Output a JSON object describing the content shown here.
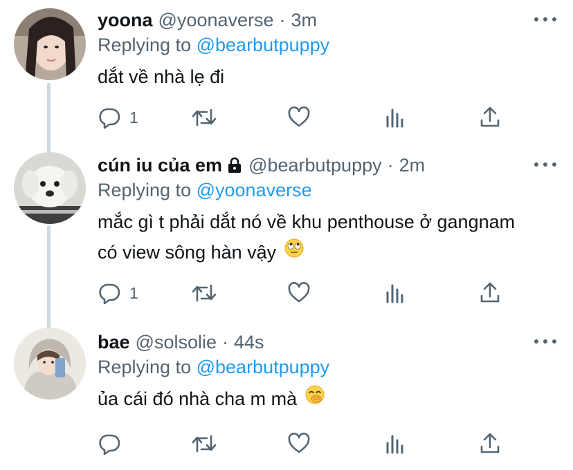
{
  "colors": {
    "accent": "#1d9bf0",
    "secondary_text": "#536471",
    "primary_text": "#0f1419"
  },
  "tweets": [
    {
      "display_name": "yoona",
      "handle": "@yoonaverse",
      "separator": "·",
      "time": "3m",
      "replying_prefix": "Replying to",
      "replying_to": "@bearbutpuppy",
      "text_lines": [
        "dắt về nhà lẹ đi"
      ],
      "reply_count": "1",
      "retweet_count": "",
      "like_count": ""
    },
    {
      "display_name": "cún iu của em",
      "protected_icon": "lock-icon",
      "handle": "@bearbutpuppy",
      "separator": "·",
      "time": "2m",
      "replying_prefix": "Replying to",
      "replying_to": "@yoonaverse",
      "text_lines": [
        "mắc gì t phải dắt nó về khu penthouse ở gangnam",
        "có view sông hàn vậy"
      ],
      "emoji": "face-with-rolling-eyes",
      "reply_count": "1",
      "retweet_count": "",
      "like_count": ""
    },
    {
      "display_name": "bae",
      "handle": "@solsolie",
      "separator": "·",
      "time": "44s",
      "replying_prefix": "Replying to",
      "replying_to": "@bearbutpuppy",
      "text_lines": [
        "ủa cái đó nhà cha m mà"
      ],
      "emoji": "face-with-hand-over-mouth",
      "reply_count": "",
      "retweet_count": "",
      "like_count": ""
    }
  ]
}
